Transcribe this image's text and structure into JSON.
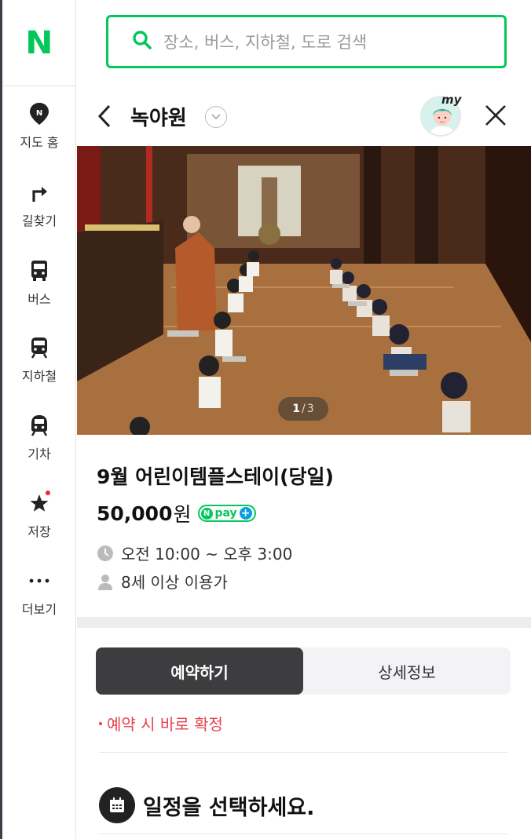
{
  "logo": "N",
  "search": {
    "placeholder": "장소, 버스, 지하철, 도로 검색"
  },
  "sidebar": {
    "items": [
      {
        "label": "지도 홈",
        "icon": "map-pin-icon"
      },
      {
        "label": "길찾기",
        "icon": "turn-arrow-icon"
      },
      {
        "label": "버스",
        "icon": "bus-icon"
      },
      {
        "label": "지하철",
        "icon": "subway-icon"
      },
      {
        "label": "기차",
        "icon": "train-icon"
      },
      {
        "label": "저장",
        "icon": "star-icon"
      },
      {
        "label": "더보기",
        "icon": "more-dots-icon"
      }
    ]
  },
  "panel": {
    "title": "녹야원",
    "avatar_badge": "my"
  },
  "photo": {
    "current": "1",
    "total": "3"
  },
  "program": {
    "title": "9월 어린이템플스테이(당일)",
    "price": "50,000",
    "price_unit": "원",
    "npay_label": "pay",
    "time": "오전 10:00 ~ 오후 3:00",
    "age": "8세 이상 이용가"
  },
  "tabs": {
    "reserve": "예약하기",
    "details": "상세정보"
  },
  "notice": "예약 시 바로 확정",
  "schedule": {
    "title": "일정을 선택하세요."
  },
  "colors": {
    "brand": "#03c75a",
    "alert": "#e8414e",
    "active_tab": "#3d3d3f"
  }
}
